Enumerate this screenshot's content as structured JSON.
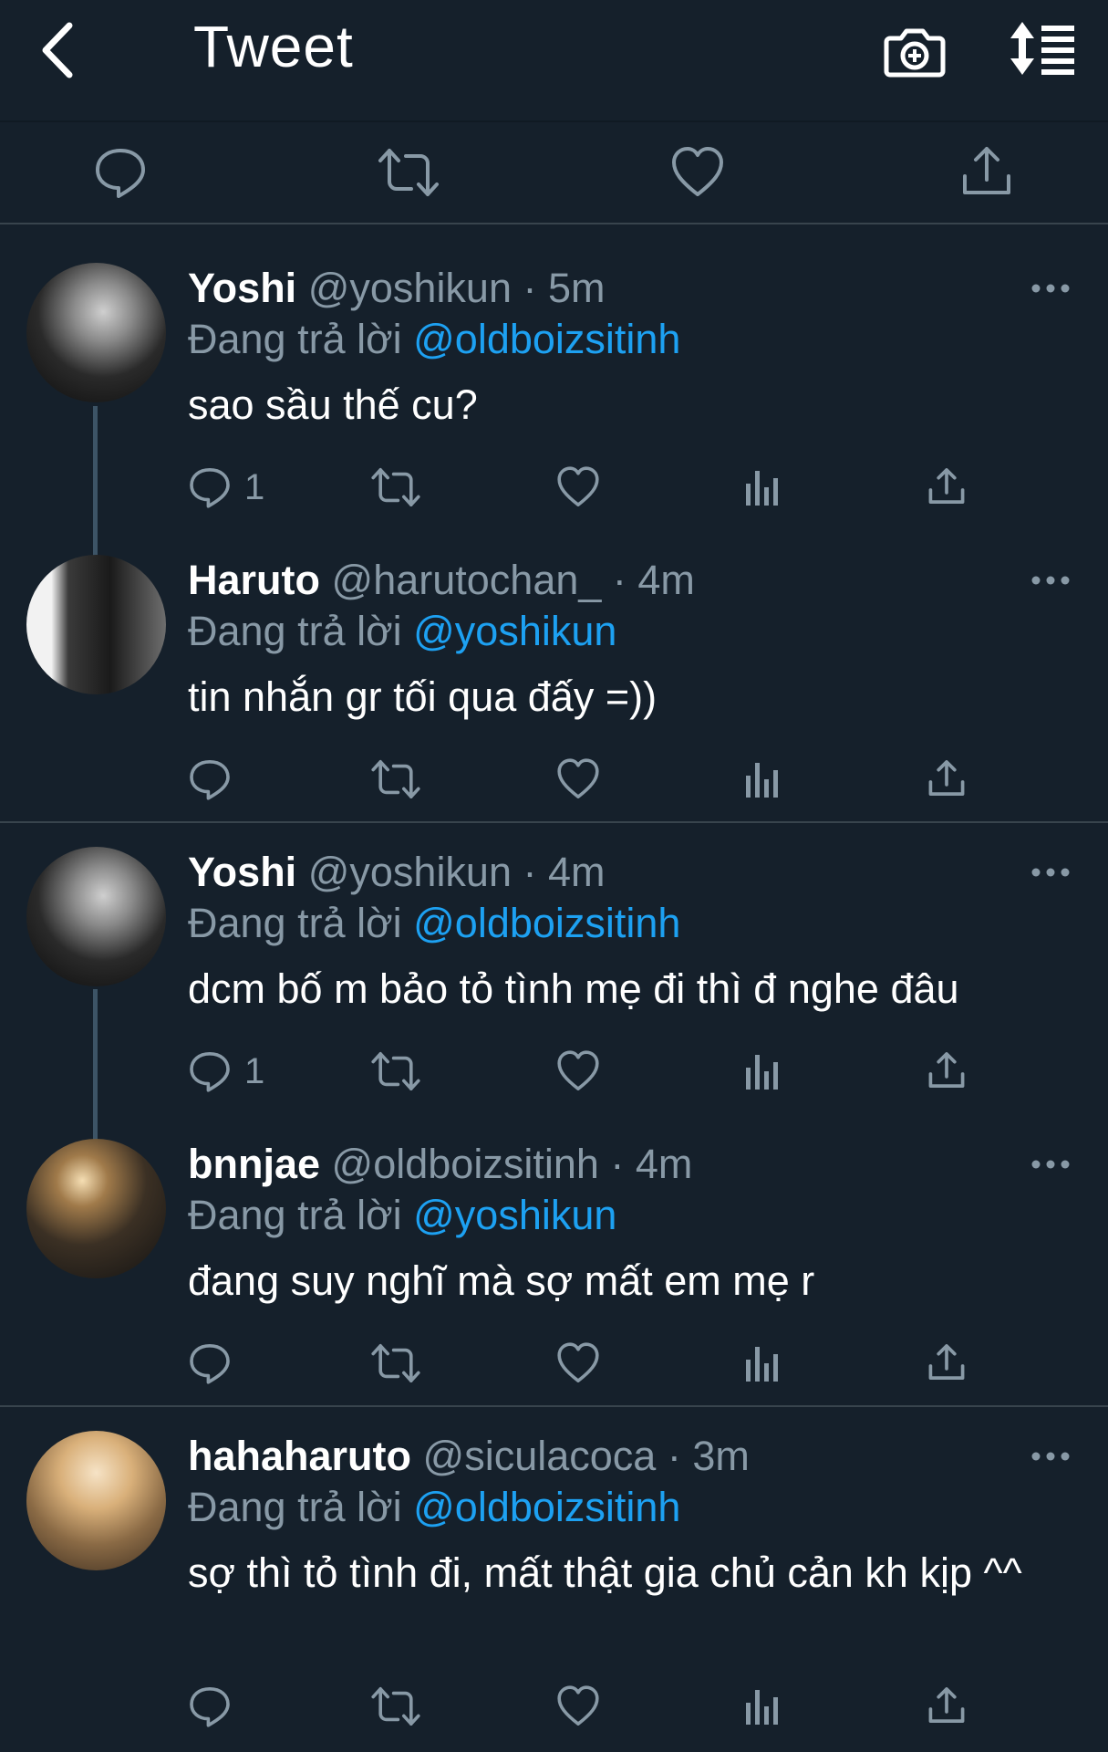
{
  "header": {
    "title": "Tweet",
    "back_icon": "chevron-left-icon",
    "camera_icon": "camera-plus-icon",
    "sort_icon": "sort-list-icon"
  },
  "colors": {
    "background": "#15202b",
    "text": "#ffffff",
    "secondary": "#8899a6",
    "accent": "#1da1f2",
    "divider": "#38444d"
  },
  "replies": [
    {
      "name": "Yoshi",
      "handle": "@yoshikun",
      "time": "· 5m",
      "reply_prefix": "Đang trả lời",
      "reply_to": "@oldboizsitinh",
      "text": "sao sầu thế cu?",
      "reply_count": "1"
    },
    {
      "name": "Haruto",
      "handle": "@harutochan_",
      "time": "· 4m",
      "reply_prefix": "Đang trả lời",
      "reply_to": "@yoshikun",
      "text": "tin nhắn gr tối qua đấy =))",
      "reply_count": ""
    },
    {
      "name": "Yoshi",
      "handle": "@yoshikun",
      "time": "· 4m",
      "reply_prefix": "Đang trả lời",
      "reply_to": "@oldboizsitinh",
      "text": "dcm bố m bảo tỏ tình mẹ đi thì đ nghe đâu",
      "reply_count": "1"
    },
    {
      "name": "bnnjae",
      "handle": "@oldboizsitinh",
      "time": "· 4m",
      "reply_prefix": "Đang trả lời",
      "reply_to": "@yoshikun",
      "text": "đang suy nghĩ mà sợ mất em mẹ r",
      "reply_count": ""
    },
    {
      "name": "hahaharuto",
      "handle": "@siculacoca",
      "time": "· 3m",
      "reply_prefix": "Đang trả lời",
      "reply_to": "@oldboizsitinh",
      "text": "sợ thì tỏ tình đi, mất thật gia chủ cản kh kịp ^^",
      "reply_count": ""
    }
  ]
}
